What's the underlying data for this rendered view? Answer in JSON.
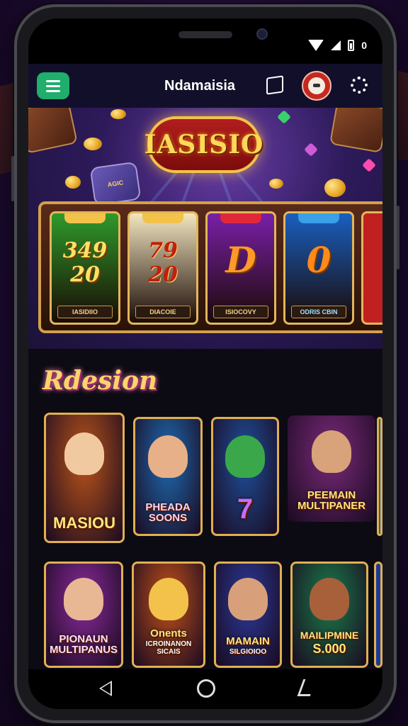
{
  "status_bar": {
    "icons": [
      "wifi-icon",
      "signal-icon",
      "battery-icon"
    ],
    "battery_text": "0"
  },
  "app_bar": {
    "title": "Ndamaisia",
    "menu_icon": "hamburger-menu-icon",
    "map_icon": "map-icon",
    "avatar_icon": "avatar",
    "loading_icon": "loading-spinner-icon",
    "menu_color": "#1fae6b"
  },
  "hero": {
    "logo_text": "IASISIO",
    "promo_badge": "AGIC",
    "reels": [
      {
        "value_line1": "349",
        "value_line2": "20",
        "label": "IASIDIIO",
        "color": "#2f9a2a"
      },
      {
        "value_line1": "79",
        "value_line2": "20",
        "label": "DIACOIE",
        "color": "#f3e6c0"
      },
      {
        "value_line1": "D",
        "value_line2": "",
        "label": "ISIOCOVY",
        "color": "#7a1fa8"
      },
      {
        "value_line1": "0",
        "value_line2": "",
        "label": "ODRIS CBIN",
        "color": "#1a5fc0"
      }
    ]
  },
  "section": {
    "title": "Rdesion"
  },
  "games_row1": [
    {
      "title": "MASIOU",
      "subtitle": "",
      "bg": "#b8531a",
      "portrait": "#f1c9a0"
    },
    {
      "title": "PHEADA SOONS",
      "subtitle": "",
      "bg": "#1e6ab0",
      "portrait": "#e8b088"
    },
    {
      "title": "7",
      "subtitle": "",
      "bg": "#1e4f9a",
      "portrait": "#3aa84a"
    },
    {
      "title": "PEEMAIN MULTIPANER",
      "subtitle": "",
      "bg": "#7a2a7a",
      "portrait": "#d8a27a"
    }
  ],
  "games_row2": [
    {
      "title": "PIONAUN MULTIPANUS",
      "subtitle": "",
      "bg": "#8a2a9a",
      "portrait": "#e8b894"
    },
    {
      "title": "Onents",
      "subtitle": "ICROINANON SICAIS",
      "bg": "#c0501a",
      "portrait": "#f2c24a"
    },
    {
      "title": "MAMAIN",
      "subtitle": "SILGIOIOO",
      "bg": "#2a3a9a",
      "portrait": "#d8a07a"
    },
    {
      "title": "MAILIPMINE",
      "subtitle": "S.000",
      "bg": "#1a7a4a",
      "portrait": "#a8603a"
    }
  ],
  "nav_bar": {
    "icons": [
      "back-icon",
      "home-icon",
      "recent-icon"
    ]
  }
}
